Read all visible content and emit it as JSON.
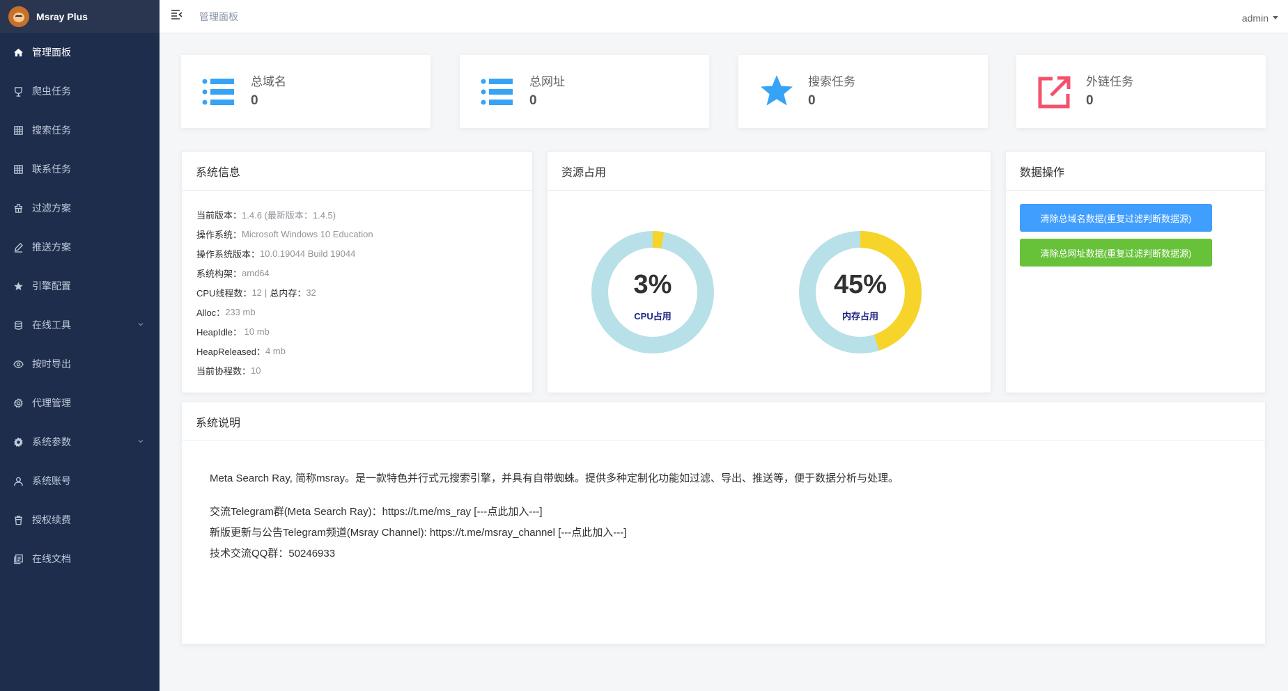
{
  "app": {
    "name": "Msray Plus"
  },
  "sidebar": {
    "items": [
      {
        "label": "管理面板",
        "icon": "home-icon",
        "active": true,
        "expandable": false
      },
      {
        "label": "爬虫任务",
        "icon": "spider-icon",
        "active": false,
        "expandable": false
      },
      {
        "label": "搜索任务",
        "icon": "grid-icon",
        "active": false,
        "expandable": false
      },
      {
        "label": "联系任务",
        "icon": "grid-icon",
        "active": false,
        "expandable": false
      },
      {
        "label": "过滤方案",
        "icon": "filter-icon",
        "active": false,
        "expandable": false
      },
      {
        "label": "推送方案",
        "icon": "edit-icon",
        "active": false,
        "expandable": false
      },
      {
        "label": "引擎配置",
        "icon": "star-icon",
        "active": false,
        "expandable": false
      },
      {
        "label": "在线工具",
        "icon": "tools-icon",
        "active": false,
        "expandable": true
      },
      {
        "label": "按时导出",
        "icon": "eye-icon",
        "active": false,
        "expandable": false
      },
      {
        "label": "代理管理",
        "icon": "gear-icon",
        "active": false,
        "expandable": false
      },
      {
        "label": "系统参数",
        "icon": "settings-icon",
        "active": false,
        "expandable": true
      },
      {
        "label": "系统账号",
        "icon": "user-icon",
        "active": false,
        "expandable": false
      },
      {
        "label": "授权续费",
        "icon": "trash-icon",
        "active": false,
        "expandable": false
      },
      {
        "label": "在线文档",
        "icon": "document-icon",
        "active": false,
        "expandable": false
      }
    ]
  },
  "topbar": {
    "breadcrumb": "管理面板",
    "user": "admin"
  },
  "stats": [
    {
      "label": "总域名",
      "value": "0",
      "icon": "list-icon",
      "color": "#36a3f7"
    },
    {
      "label": "总网址",
      "value": "0",
      "icon": "list-icon",
      "color": "#36a3f7"
    },
    {
      "label": "搜索任务",
      "value": "0",
      "icon": "star-icon",
      "color": "#36a3f7"
    },
    {
      "label": "外链任务",
      "value": "0",
      "icon": "external-link-icon",
      "color": "#f4516c"
    }
  ],
  "system_info": {
    "title": "系统信息",
    "rows": [
      {
        "label": "当前版本：",
        "value": "1.4.6 (最新版本：1.4.5)"
      },
      {
        "label": "操作系统：",
        "value": "Microsoft Windows 10 Education"
      },
      {
        "label": "操作系统版本：",
        "value": "10.0.19044 Build 19044"
      },
      {
        "label": "系统构架：",
        "value": "amd64"
      },
      {
        "label": "CPU线程数：",
        "value": "12",
        "label2": "总内存：",
        "value2": "32"
      },
      {
        "label": "Alloc：",
        "value": "233 mb"
      },
      {
        "label": "HeapIdle：",
        "value": " 10 mb"
      },
      {
        "label": "HeapReleased：",
        "value": "4 mb"
      },
      {
        "label": "当前协程数：",
        "value": "10"
      }
    ]
  },
  "resources": {
    "title": "资源占用",
    "cpu": {
      "percent": 3,
      "text": "3%",
      "label": "CPU占用"
    },
    "memory": {
      "percent": 45,
      "text": "45%",
      "label": "内存占用"
    },
    "colors": {
      "used": "#f7d42a",
      "free": "#b8e0e8"
    }
  },
  "data_ops": {
    "title": "数据操作",
    "btn_domains": "清除总域名数据(重复过滤判断数据源)",
    "btn_urls": "清除总网址数据(重复过滤判断数据源)"
  },
  "description": {
    "title": "系统说明",
    "intro": "Meta Search Ray, 简称msray。是一款特色并行式元搜索引擎，并具有自带蜘蛛。提供多种定制化功能如过滤、导出、推送等，便于数据分析与处理。",
    "lines": [
      "交流Telegram群(Meta Search Ray)：https://t.me/ms_ray [---点此加入---]",
      "新版更新与公告Telegram频道(Msray Channel): https://t.me/msray_channel [---点此加入---]",
      "技术交流QQ群：50246933"
    ]
  }
}
